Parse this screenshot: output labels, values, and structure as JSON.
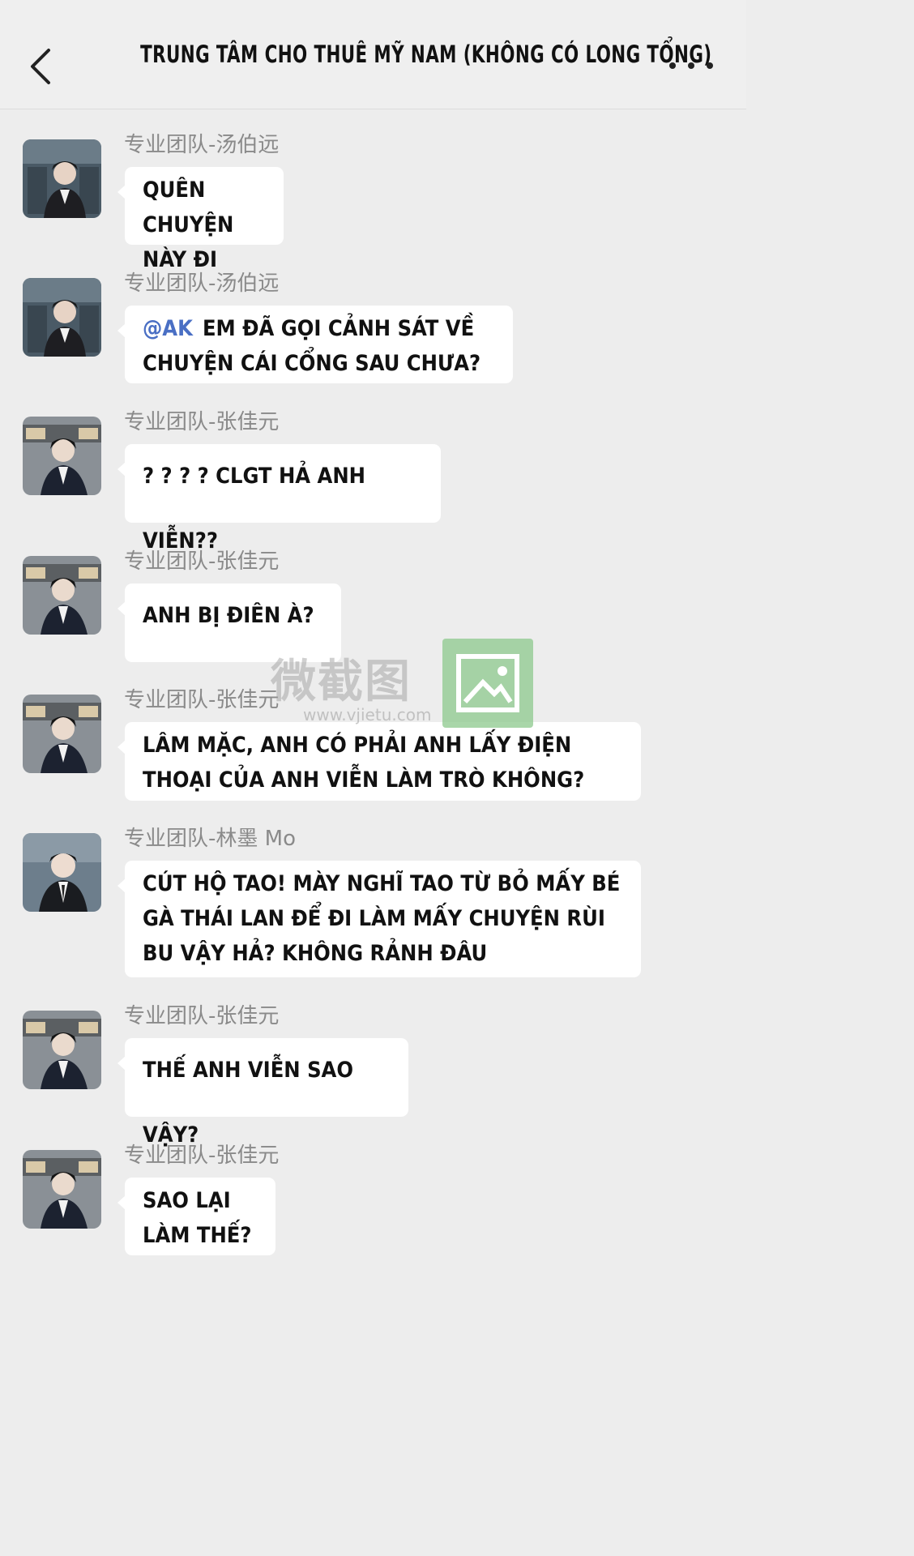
{
  "header": {
    "title": "TRUNG TÂM CHO THUÊ MỸ NAM (KHÔNG CÓ LONG TỔNG)",
    "back_icon": "chevron-left-icon",
    "more_icon": "more-dots-icon"
  },
  "messages": [
    {
      "sender": "专业团队-汤伯远",
      "mention": "",
      "text": "QUÊN CHUYỆN NÀY ĐI"
    },
    {
      "sender": "专业团队-汤伯远",
      "mention": "@AK",
      "text": "EM ĐÃ GỌI CẢNH SÁT VỀ CHUYỆN CÁI CỔNG SAU CHƯA?"
    },
    {
      "sender": "专业团队-张佳元",
      "mention": "",
      "text": "? ? ? ? CLGT HẢ ANH VIỄN??"
    },
    {
      "sender": "专业团队-张佳元",
      "mention": "",
      "text": "ANH BỊ ĐIÊN À?"
    },
    {
      "sender": "专业团队-张佳元",
      "mention": "",
      "text": "LÂM MẶC, ANH CÓ PHẢI ANH LẤY ĐIỆN THOẠI CỦA ANH VIỄN LÀM TRÒ KHÔNG?"
    },
    {
      "sender": "专业团队-林墨 Mo",
      "mention": "",
      "text": "CÚT HỘ TAO! MÀY NGHĨ TAO TỪ BỎ MẤY BÉ GÀ THÁI LAN ĐỂ ĐI LÀM MẤY CHUYỆN RÙI BU VẬY HẢ? KHÔNG RẢNH ĐÂU"
    },
    {
      "sender": "专业团队-张佳元",
      "mention": "",
      "text": "THẾ ANH VIỄN SAO VẬY?"
    },
    {
      "sender": "专业团队-张佳元",
      "mention": "",
      "text": "SAO LẠI LÀM THẾ?"
    }
  ],
  "watermark": {
    "text": "微截图",
    "url": "www.vjietu.com"
  }
}
